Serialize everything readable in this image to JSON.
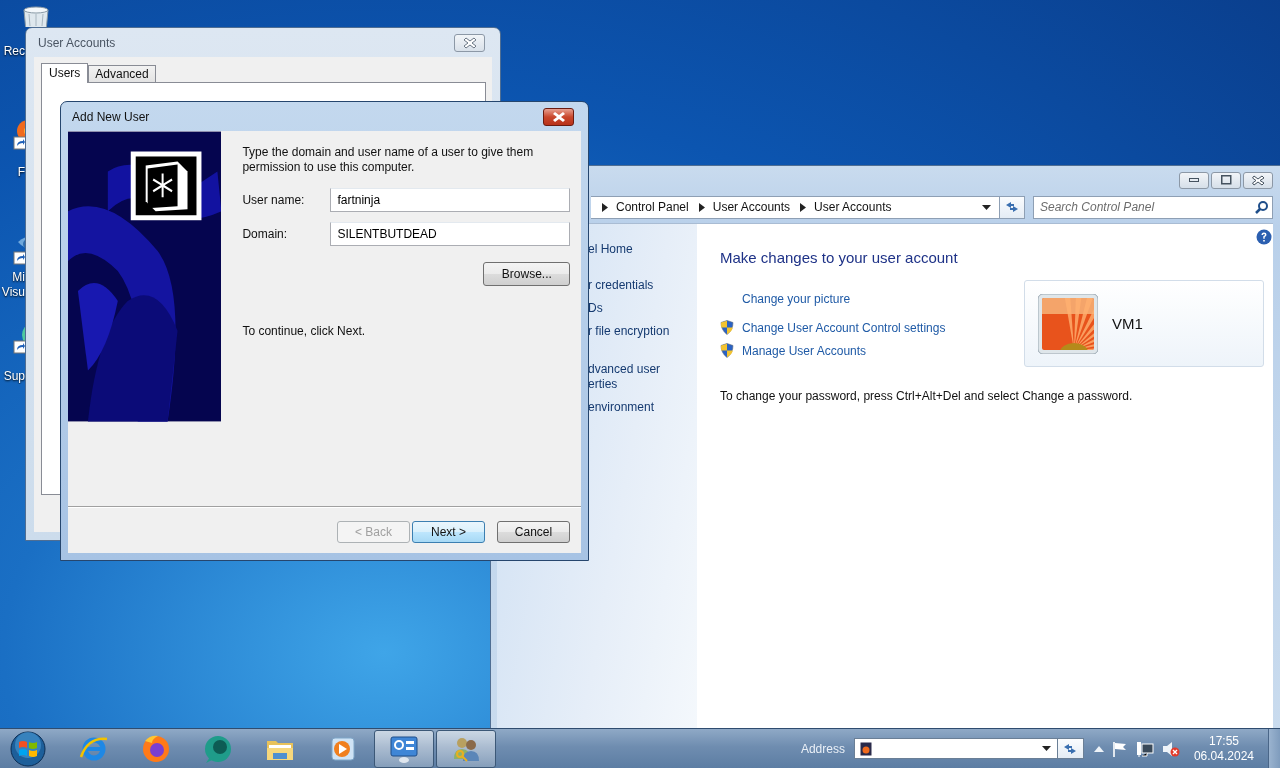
{
  "desktop_icons": [
    {
      "label_lines": [
        "Rec"
      ]
    },
    {
      "label_lines": [
        "F"
      ]
    },
    {
      "label_lines": [
        "Mi",
        "Visu"
      ]
    },
    {
      "label_lines": [
        "Sup"
      ]
    }
  ],
  "user_accounts_window": {
    "title": "User Accounts",
    "tabs": [
      {
        "label": "Users",
        "selected": true
      },
      {
        "label": "Advanced",
        "selected": false
      }
    ]
  },
  "add_user_dialog": {
    "title": "Add New User",
    "instruction": "Type the domain and user name of a user to give them permission to use this computer.",
    "fields": [
      {
        "label": "User name:",
        "value": "fartninja"
      },
      {
        "label": "Domain:",
        "value": "SILENTBUTDEAD"
      }
    ],
    "browse_button": "Browse...",
    "hint": "To continue, click Next.",
    "buttons": [
      {
        "label": "< Back",
        "disabled": true,
        "default": false
      },
      {
        "label": "Next >",
        "disabled": false,
        "default": true
      },
      {
        "label": "Cancel",
        "disabled": false,
        "default": false
      }
    ]
  },
  "control_panel": {
    "breadcrumb": [
      "Control Panel",
      "User Accounts",
      "User Accounts"
    ],
    "search": {
      "placeholder": "Search Control Panel"
    },
    "sidebar": {
      "items": [
        {
          "lines": [
            "el Home"
          ]
        },
        {
          "lines": [
            "r credentials"
          ]
        },
        {
          "lines": [
            "Ds"
          ]
        },
        {
          "lines": [
            "r file encryption"
          ]
        },
        {
          "lines": [
            "dvanced user",
            "erties"
          ]
        },
        {
          "lines": [
            "environment"
          ]
        }
      ]
    },
    "heading": "Make changes to your user account",
    "tasks": [
      {
        "label": "Change your picture",
        "shield": false
      },
      {
        "label": "Change User Account Control settings",
        "shield": true
      },
      {
        "label": "Manage User Accounts",
        "shield": true
      }
    ],
    "password_note": "To change your password, press Ctrl+Alt+Del and select Change a password.",
    "account": {
      "name": "VM1"
    }
  },
  "taskbar": {
    "buttons": [
      {
        "active": false
      },
      {
        "active": false
      },
      {
        "active": false
      },
      {
        "active": false
      },
      {
        "active": false
      },
      {
        "active": true
      },
      {
        "active": true
      }
    ],
    "address_toolbar": {
      "label": "Address"
    },
    "clock": {
      "time": "17:55",
      "date": "06.04.2024"
    }
  }
}
